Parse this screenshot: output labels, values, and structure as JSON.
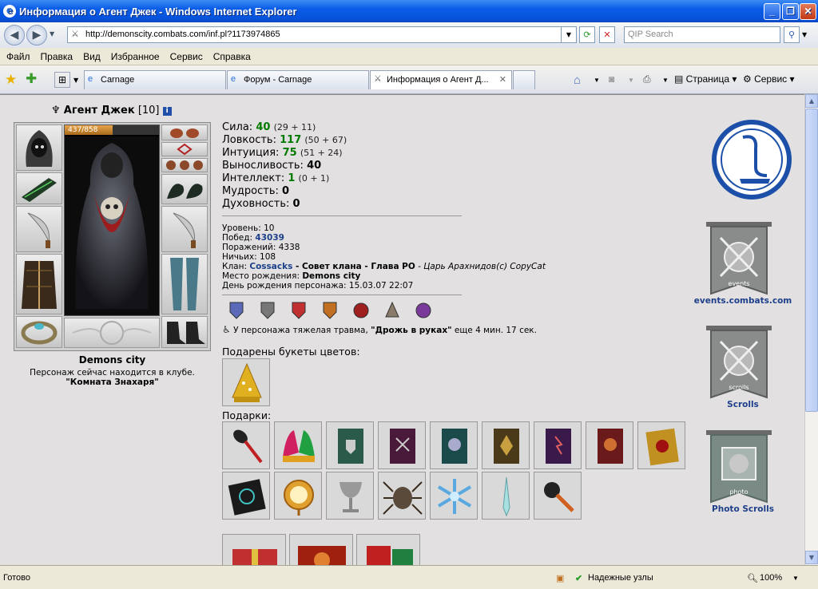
{
  "window": {
    "title": "Информация о Агент Джек - Windows Internet Explorer"
  },
  "address": {
    "url": "http://demonscity.combats.com/inf.pl?1173974865",
    "search_placeholder": "QIP Search"
  },
  "menu": [
    "Файл",
    "Правка",
    "Вид",
    "Избранное",
    "Сервис",
    "Справка"
  ],
  "tabs": [
    {
      "label": "Carnage"
    },
    {
      "label": "Форум - Carnage"
    },
    {
      "label": "Информация о Агент Д..."
    }
  ],
  "commands": {
    "page": "Страница",
    "tools": "Сервис"
  },
  "character": {
    "name": "Агент Джек",
    "level": "[10]",
    "hp": "437/858",
    "hp_fraction": 0.509,
    "city": "Demons city",
    "location_text": "Персонаж сейчас находится в клубе.",
    "room": "\"Комната Знахаря\""
  },
  "stats": [
    {
      "label": "Сила:",
      "value": "40",
      "bonus": "(29 + 11)",
      "green": true
    },
    {
      "label": "Ловкость:",
      "value": "117",
      "bonus": "(50 + 67)",
      "green": true
    },
    {
      "label": "Интуиция:",
      "value": "75",
      "bonus": "(51 + 24)",
      "green": true
    },
    {
      "label": "Выносливость:",
      "value": "40",
      "bonus": "",
      "green": false
    },
    {
      "label": "Интеллект:",
      "value": "1",
      "bonus": "(0 + 1)",
      "green": true
    },
    {
      "label": "Мудрость:",
      "value": "0",
      "bonus": "",
      "green": false
    },
    {
      "label": "Духовность:",
      "value": "0",
      "bonus": "",
      "green": false
    }
  ],
  "info": {
    "level": "Уровень: 10",
    "wins_label": "Побед:",
    "wins": "43039",
    "losses": "Поражений: 4338",
    "draws": "Ничьих: 108",
    "clan_label": "Клан:",
    "clan": "Cossacks",
    "clan_rest": " - Совет клана - Глава РО",
    "clan_title": " - Царь Арахнидов(с) CopyCat",
    "birthplace_label": "Место рождения:",
    "birthplace": "Demons city",
    "birthday": "День рождения персонажа: 15.03.07 22:07"
  },
  "trauma": {
    "prefix": "У персонажа тяжелая травма,",
    "name": "\"Дрожь в руках\"",
    "suffix": "еще 4 мин. 17 сек."
  },
  "flowers_label": "Подарены букеты цветов:",
  "gifts_label": "Подарки:",
  "sidebar": {
    "events": "events.combats.com",
    "events_banner": "events",
    "scrolls": "Scrolls",
    "scrolls_banner": "scrolls",
    "photo": "Photo Scrolls",
    "photo_banner": "photo"
  },
  "status": {
    "ready": "Готово",
    "zone": "Надежные узлы",
    "zoom": "100%"
  },
  "colors": {
    "stat_green": "#007a00",
    "link_blue": "#1b3f8a",
    "page_bg": "#e2e0e0"
  }
}
